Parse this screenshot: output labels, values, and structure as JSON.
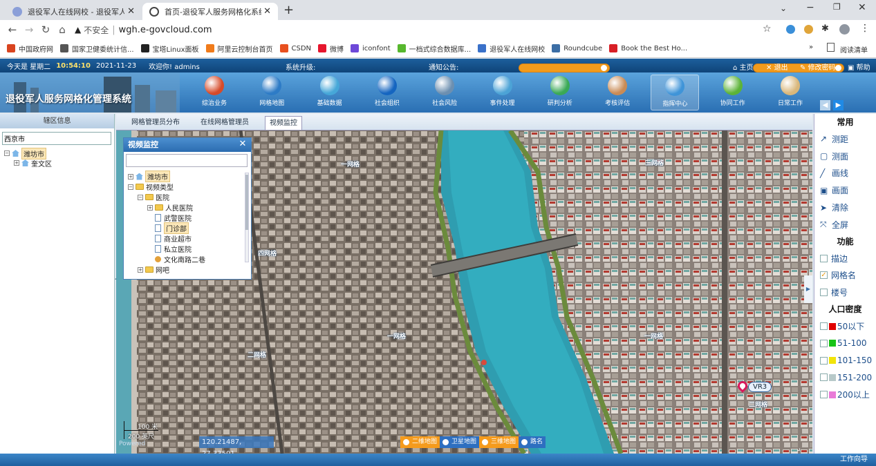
{
  "browser": {
    "tabs": [
      {
        "title": "退役军人在线网校 - 退役军人服务"
      },
      {
        "title": "首页-退役军人服务网格化系统"
      }
    ],
    "address": {
      "security": "不安全",
      "url": "wgh.e-govcloud.com"
    },
    "bookmarks": [
      {
        "label": "中国政府网",
        "color": "#d9441f"
      },
      {
        "label": "国家卫健委统计信...",
        "color": "#555555"
      },
      {
        "label": "宝塔Linux面板",
        "color": "#222222"
      },
      {
        "label": "阿里云控制台首页",
        "color": "#f07b1b"
      },
      {
        "label": "CSDN",
        "color": "#e8501f"
      },
      {
        "label": "微博",
        "color": "#e6162d"
      },
      {
        "label": "iconfont",
        "color": "#6e49d8"
      },
      {
        "label": "一档式综合数据库...",
        "color": "#57b82e"
      },
      {
        "label": "退役军人在线网校",
        "color": "#3a71c9"
      },
      {
        "label": "Roundcube",
        "color": "#3c6ea5"
      },
      {
        "label": "Book the Best Ho...",
        "color": "#d81f26"
      }
    ],
    "reading_list": "阅读清单",
    "more": "»"
  },
  "status": {
    "today_label": "今天是 星期二",
    "time": "10:54:10",
    "date": "2021-11-23",
    "welcome": "欢迎你! admins",
    "upgrade_label": "系统升级:",
    "notice_label": "通知公告:",
    "links": [
      "主页",
      "退出",
      "修改密码",
      "帮助"
    ]
  },
  "banner": {
    "title": "退役军人服务网格化管理系统",
    "nav": [
      {
        "label": "综治业务",
        "color": "#d64b2a"
      },
      {
        "label": "网格地图",
        "color": "#2d7bc6"
      },
      {
        "label": "基础数据",
        "color": "#46a7d8"
      },
      {
        "label": "社会组织",
        "color": "#1565c0"
      },
      {
        "label": "社会风险",
        "color": "#6c8fb0"
      },
      {
        "label": "事件处理",
        "color": "#4ca3d6"
      },
      {
        "label": "研判分析",
        "color": "#3aa956"
      },
      {
        "label": "考核评估",
        "color": "#c98b55"
      },
      {
        "label": "指挥中心",
        "color": "#3f94d8"
      },
      {
        "label": "协同工作",
        "color": "#5cb338"
      },
      {
        "label": "日常工作",
        "color": "#d9b77a"
      }
    ],
    "active_index": 8
  },
  "left": {
    "title": "辖区信息",
    "input_value": "西京市",
    "tree": [
      {
        "label": "潍坊市",
        "level": 0,
        "highlight": true
      },
      {
        "label": "奎文区",
        "level": 1,
        "highlight": false
      }
    ]
  },
  "tabs": [
    "网格管理员分布",
    "在线网格管理员",
    "视频监控"
  ],
  "active_tab": 2,
  "popup": {
    "title": "视频监控",
    "close": "✕",
    "tree": [
      {
        "label": "潍坊市",
        "level": 0,
        "type": "home",
        "pm": "+",
        "highlight": true
      },
      {
        "label": "视频类型",
        "level": 0,
        "type": "folder",
        "pm": "-"
      },
      {
        "label": "医院",
        "level": 1,
        "type": "folder",
        "pm": "-"
      },
      {
        "label": "人民医院",
        "level": 2,
        "type": "folder",
        "pm": "+"
      },
      {
        "label": "武警医院",
        "level": 2,
        "type": "file"
      },
      {
        "label": "门诊部",
        "level": 2,
        "type": "file",
        "highlight": true
      },
      {
        "label": "商业超市",
        "level": 2,
        "type": "file"
      },
      {
        "label": "私立医院",
        "level": 2,
        "type": "file"
      },
      {
        "label": "文化南路二巷",
        "level": 2,
        "type": "cam"
      },
      {
        "label": "网吧",
        "level": 1,
        "type": "folder",
        "pm": "+"
      }
    ]
  },
  "map": {
    "grid_labels": [
      {
        "text": "一网格"
      },
      {
        "text": "三网格"
      },
      {
        "text": "四网格"
      },
      {
        "text": "一网格"
      },
      {
        "text": "二网格"
      },
      {
        "text": "一网格"
      },
      {
        "text": "二网格"
      }
    ],
    "vr_marker": "VR3",
    "scale": [
      "100 米",
      "200 英尺"
    ],
    "powered": "Powered",
    "coords": "120.21487, 27.33501",
    "map_types": [
      {
        "label": "二维地图",
        "active": true
      },
      {
        "label": "卫星地图",
        "active": false
      },
      {
        "label": "三维地图",
        "active": true
      },
      {
        "label": "路名",
        "active": false
      }
    ]
  },
  "right": {
    "common_title": "常用",
    "common": [
      {
        "label": "测距",
        "icon": "ruler-icon"
      },
      {
        "label": "测面",
        "icon": "area-icon"
      },
      {
        "label": "画线",
        "icon": "line-icon"
      },
      {
        "label": "画面",
        "icon": "polygon-icon"
      },
      {
        "label": "清除",
        "icon": "eraser-icon"
      },
      {
        "label": "全屏",
        "icon": "fullscreen-icon"
      }
    ],
    "func_title": "功能",
    "functions": [
      {
        "label": "描边",
        "checked": false
      },
      {
        "label": "网格名",
        "checked": true
      },
      {
        "label": "楼号",
        "checked": false
      }
    ],
    "density_title": "人口密度",
    "density": [
      {
        "label": "50以下",
        "color": "#e00000"
      },
      {
        "label": "51-100",
        "color": "#18c418"
      },
      {
        "label": "101-150",
        "color": "#f2e40a"
      },
      {
        "label": "151-200",
        "color": "#b7c9c9"
      },
      {
        "label": "200以上",
        "color": "#e87bd8"
      }
    ]
  },
  "bottom": {
    "work_guide": "工作向导"
  }
}
